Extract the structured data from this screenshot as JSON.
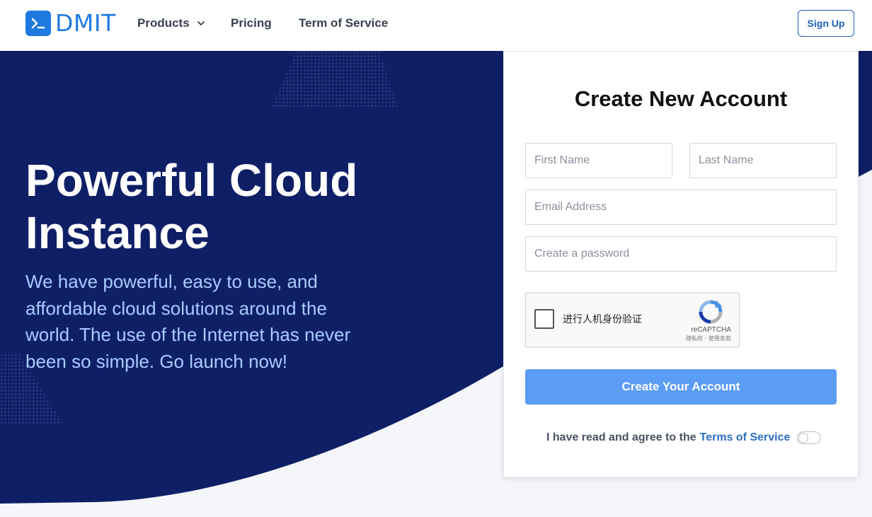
{
  "navbar": {
    "brand": "DMIT",
    "items": [
      {
        "label": "Products",
        "has_dropdown": true
      },
      {
        "label": "Pricing"
      },
      {
        "label": "Term of Service"
      }
    ],
    "signup_label": "Sign Up"
  },
  "hero": {
    "title_line1": "Powerful Cloud",
    "title_line2": "Instance",
    "subtitle_lines": [
      "We have powerful, easy to use, and",
      "affordable cloud solutions around the",
      "world. The use of the Internet has never",
      "been so simple. Go launch now!"
    ]
  },
  "form": {
    "title": "Create New Account",
    "first_name_placeholder": "First Name",
    "last_name_placeholder": "Last Name",
    "email_placeholder": "Email Address",
    "password_placeholder": "Create a password",
    "captcha": {
      "label": "进行人机身份验证",
      "brand": "reCAPTCHA",
      "links": "隐私权 - 使用条款"
    },
    "submit_label": "Create Your Account",
    "agree_text": "I have read and agree to the",
    "agree_link": "Terms of Service",
    "agree_toggle_on": false
  },
  "colors": {
    "hero_navy": "#0f1f66",
    "brand_blue": "#1f7ae0",
    "button_blue": "#5b9cf5",
    "link_blue": "#2b6fc2",
    "subtitle_blue": "#a8ccff"
  }
}
